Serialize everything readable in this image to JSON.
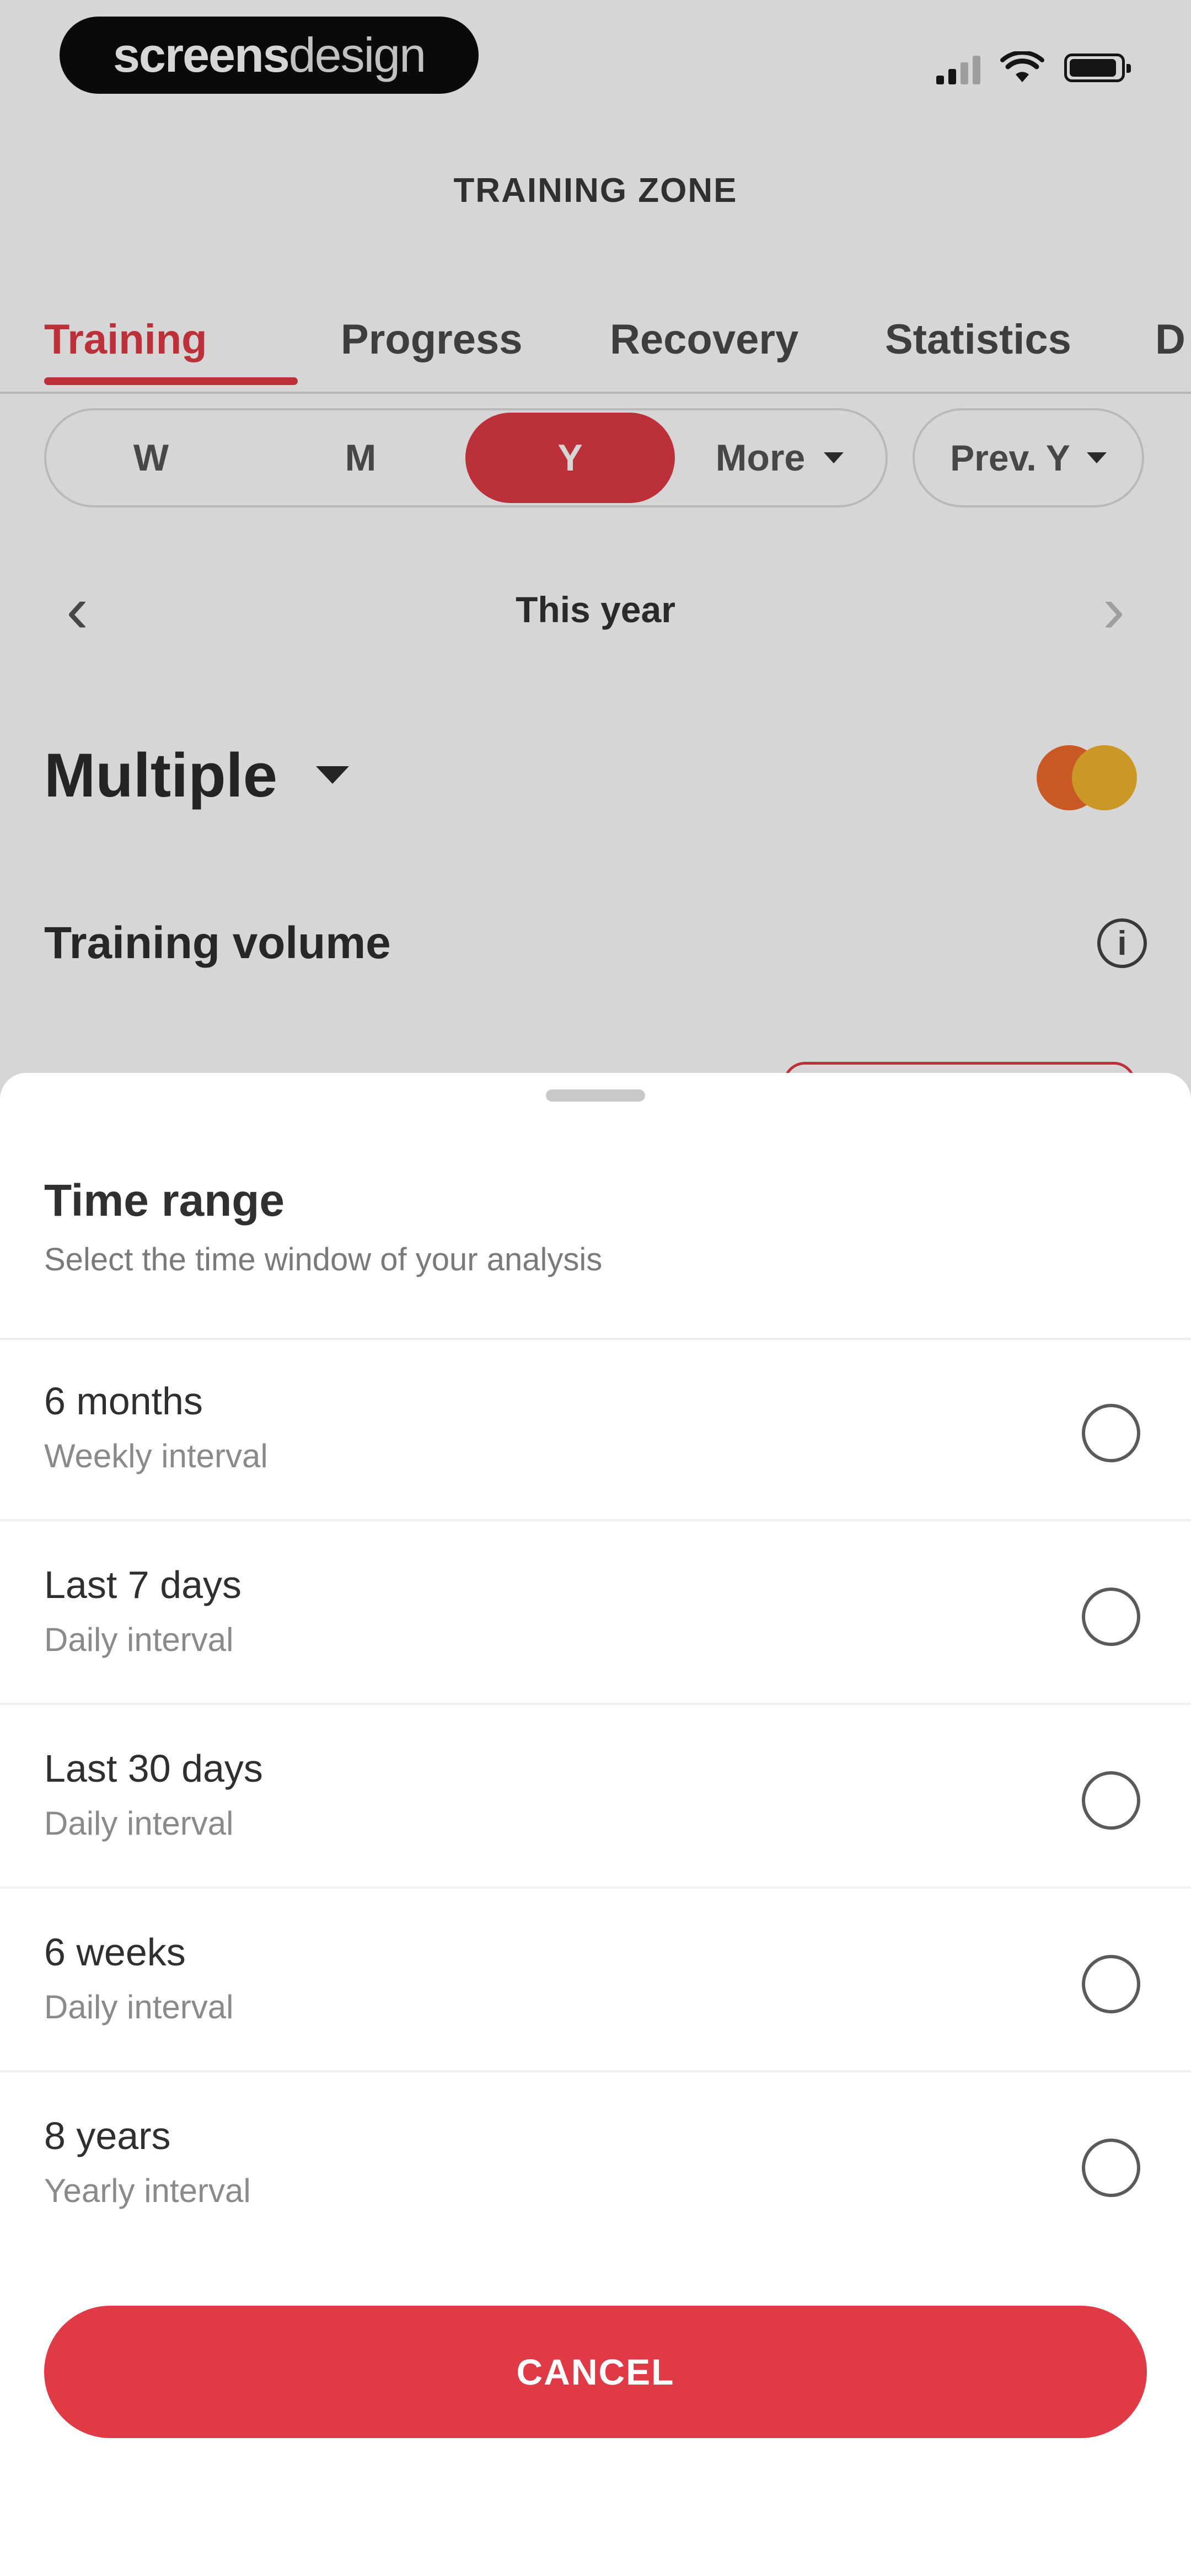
{
  "status_bar": {
    "brand_left": "screens",
    "brand_right": "design"
  },
  "header": {
    "title": "TRAINING ZONE"
  },
  "tabs": [
    {
      "label": "Training"
    },
    {
      "label": "Progress"
    },
    {
      "label": "Recovery"
    },
    {
      "label": "Statistics"
    },
    {
      "label": "D"
    }
  ],
  "period": {
    "buttons": [
      {
        "label": "W"
      },
      {
        "label": "M"
      },
      {
        "label": "Y"
      }
    ],
    "more_label": "More",
    "prev_label": "Prev. Y"
  },
  "date_nav": {
    "title": "This year",
    "prev_icon": "chevron-left",
    "next_icon": "chevron-right"
  },
  "sport": {
    "title": "Multiple"
  },
  "volume": {
    "title": "Training volume",
    "info_icon": "i"
  },
  "sheet": {
    "title": "Time range",
    "subtitle": "Select the time window of your analysis",
    "options": [
      {
        "label": "6 months",
        "sub": "Weekly interval"
      },
      {
        "label": "Last 7 days",
        "sub": "Daily interval"
      },
      {
        "label": "Last 30 days",
        "sub": "Daily interval"
      },
      {
        "label": "6 weeks",
        "sub": "Daily interval"
      },
      {
        "label": "8 years",
        "sub": "Yearly interval"
      }
    ],
    "cancel_label": "CANCEL"
  },
  "colors": {
    "accent": "#e03a46",
    "sport_orange": "#ef6a2c",
    "sport_yellow": "#f2b630"
  }
}
